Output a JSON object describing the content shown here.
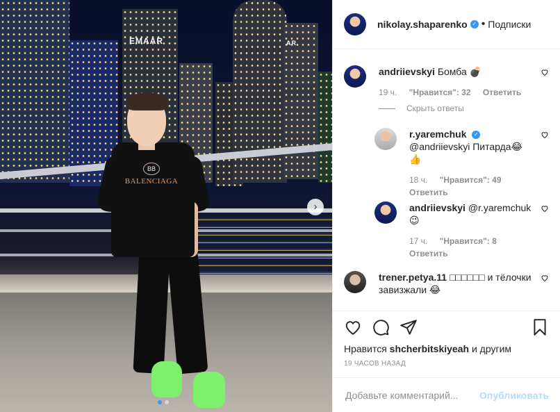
{
  "post": {
    "author": "nikolay.shaparenko",
    "follow_label": "Подписки",
    "separator": "•",
    "photo_sign": "EMAAR",
    "photo_sign2": "AR",
    "shirt_brand": "BALENCIAGA",
    "shirt_logo": "BB",
    "carousel": {
      "current": 1,
      "total": 2
    }
  },
  "comments": [
    {
      "user": "andriievskyi",
      "text": "Бомба 💣",
      "time": "19 ч.",
      "likes": "\"Нравится\": 32",
      "reply": "Ответить"
    }
  ],
  "hide_replies": "Скрыть ответы",
  "replies": [
    {
      "user": "r.yaremchuk",
      "verified": true,
      "text": "@andriievskyi Питарда😂👍",
      "time": "18 ч.",
      "likes": "\"Нравится\": 49",
      "reply": "Ответить"
    },
    {
      "user": "andriievskyi",
      "verified": false,
      "text": "@r.yaremchuk 😉",
      "time": "17 ч.",
      "likes": "\"Нравится\": 8",
      "reply": "Ответить"
    }
  ],
  "comment2": {
    "user": "trener.petya.11",
    "text": "□□□□□□ и тёлочки завизжали 😂"
  },
  "likes_line": {
    "prefix": "Нравится",
    "user": "shcherbitskiyeah",
    "suffix": "и другим"
  },
  "timestamp": "19 ЧАСОВ НАЗАД",
  "add_comment": {
    "placeholder": "Добавьте комментарий...",
    "publish": "Опубликовать"
  },
  "icons": [
    "heart-icon",
    "comment-icon",
    "share-icon",
    "bookmark-icon",
    "chevron-right-icon",
    "verified-icon"
  ]
}
